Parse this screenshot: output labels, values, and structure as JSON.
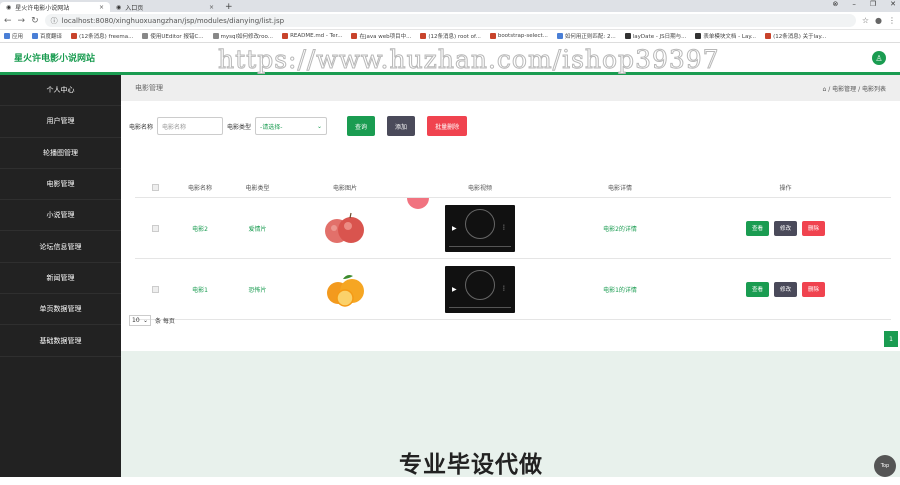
{
  "browser": {
    "tabs": [
      {
        "label": "星火许电影小说网站"
      },
      {
        "label": "入口页"
      }
    ],
    "url": "localhost:8080/xinghuoxuangzhan/jsp/modules/dianying/list.jsp",
    "bookmarks": [
      "应用",
      "百度翻译",
      "(12条消息) freema...",
      "使用UEditor 报错C...",
      "mysql如何修改roo...",
      "README.md - Ter...",
      "在java web项目中...",
      "(12条消息) root of...",
      "bootstrap-select...",
      "如何用正则匹配: 2...",
      "layDate - JS日期与...",
      "表单模块文档 - Lay...",
      "(12条消息) 关于lay..."
    ]
  },
  "header": {
    "site_title": "星火许电影小说网站",
    "watermark": "https://www.huzhan.com/ishop39397"
  },
  "sidebar": {
    "items": [
      "个人中心",
      "用户管理",
      "轮播图管理",
      "电影管理",
      "小说管理",
      "论坛信息管理",
      "新闻管理",
      "单页数据管理",
      "基础数据管理"
    ]
  },
  "page": {
    "heading": "电影管理",
    "breadcrumb": "⌂ / 电影管理 / 电影列表"
  },
  "filter": {
    "name_label": "电影名称",
    "name_placeholder": "电影名称",
    "type_label": "电影类型",
    "type_selected": "-请选择-",
    "search_button": "查询",
    "add_button": "添加",
    "batch_delete_button": "批量删除"
  },
  "table": {
    "headers": [
      "电影名称",
      "电影类型",
      "电影图片",
      "电影视频",
      "电影详情",
      "操作"
    ],
    "rows": [
      {
        "name": "电影2",
        "type": "爱情片",
        "image": "apple",
        "detail": "电影2的详情"
      },
      {
        "name": "电影1",
        "type": "恐怖片",
        "image": "orange",
        "detail": "电影1的详情"
      }
    ],
    "actions": {
      "view": "查看",
      "edit": "修改",
      "delete": "删除"
    }
  },
  "pagination": {
    "page_size": "10",
    "per_page_label": "条 每页",
    "current_page": "1"
  },
  "footer": {
    "caption": "专业毕设代做",
    "top_button": "Top"
  },
  "colors": {
    "accent": "#1a9c51",
    "danger": "#f0434f",
    "sidebar": "#222222"
  }
}
